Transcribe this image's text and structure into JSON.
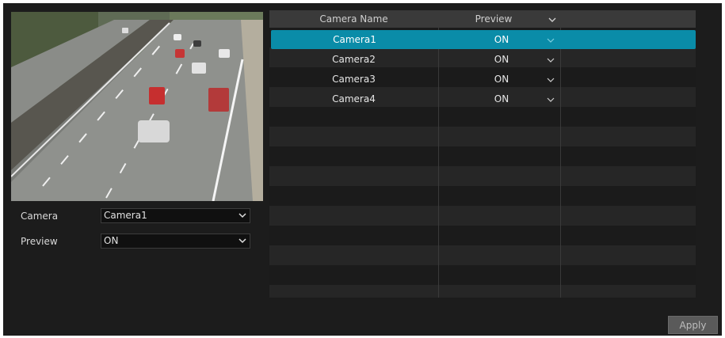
{
  "form": {
    "camera_label": "Camera",
    "camera_value": "Camera1",
    "preview_label": "Preview",
    "preview_value": "ON"
  },
  "table": {
    "headers": [
      "Camera Name",
      "Preview"
    ],
    "rows": [
      {
        "name": "Camera1",
        "preview": "ON",
        "selected": true
      },
      {
        "name": "Camera2",
        "preview": "ON",
        "selected": false
      },
      {
        "name": "Camera3",
        "preview": "ON",
        "selected": false
      },
      {
        "name": "Camera4",
        "preview": "ON",
        "selected": false
      }
    ]
  },
  "buttons": {
    "apply": "Apply"
  },
  "colors": {
    "selected_row": "#0a8ca8",
    "panel_bg": "#1c1c1c",
    "header_bg": "#3a3a3a"
  },
  "icons": {
    "dropdown": "chevron-down-icon"
  }
}
